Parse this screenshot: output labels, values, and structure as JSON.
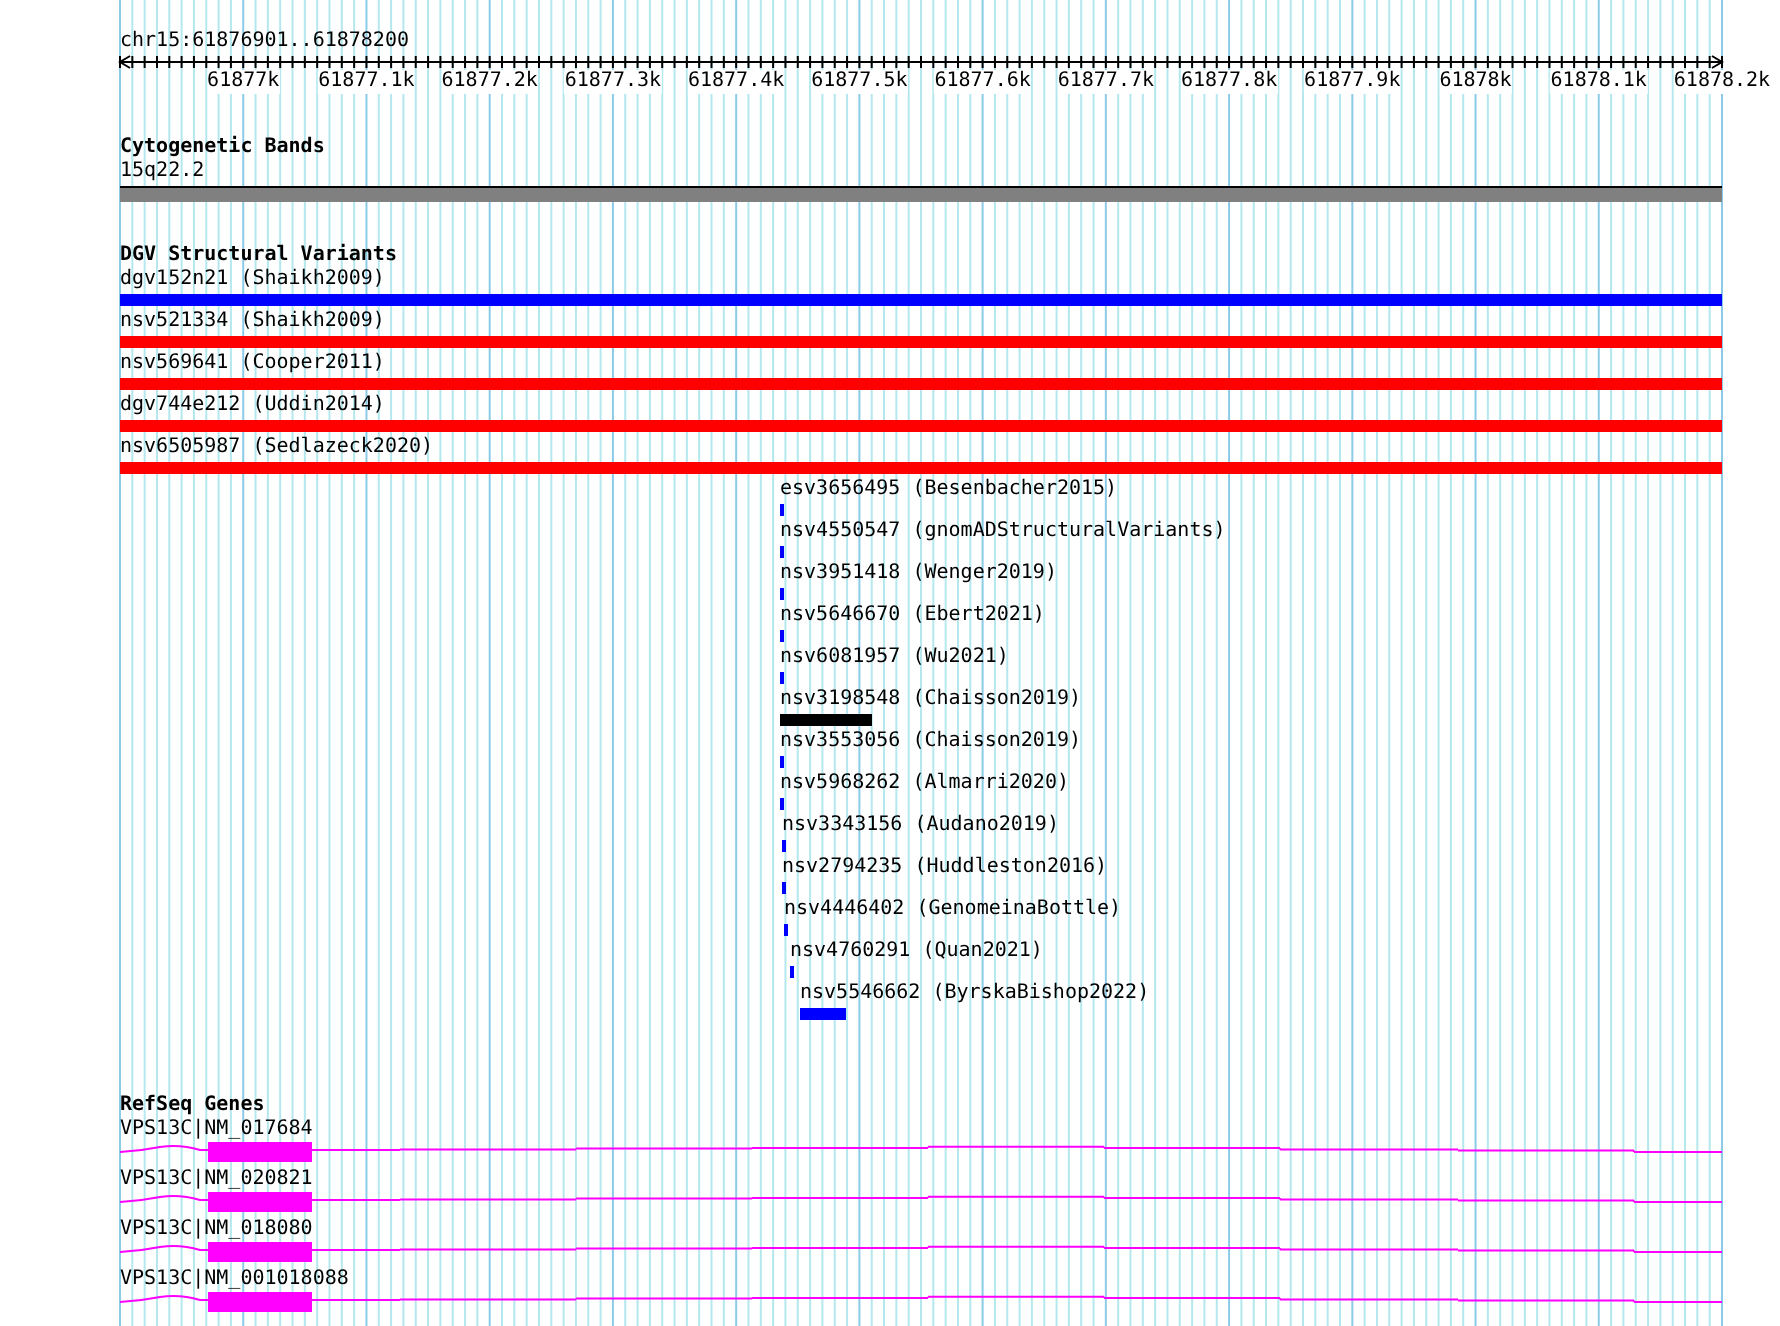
{
  "location": "chr15:61876901..61878200",
  "ruler": {
    "labels": [
      "61877k",
      "61877.1k",
      "61877.2k",
      "61877.3k",
      "61877.4k",
      "61877.5k",
      "61877.6k",
      "61877.7k",
      "61877.8k",
      "61877.9k",
      "61878k",
      "61878.1k",
      "61878.2k"
    ]
  },
  "cytogenetic_bands": {
    "title": "Cytogenetic Bands",
    "band": {
      "label": "15q22.2",
      "color": "#808080"
    }
  },
  "dgv_structural_variants": {
    "title": "DGV Structural Variants",
    "variants": [
      {
        "label": "dgv152n21 (Shaikh2009)",
        "color": "#0000ff"
      },
      {
        "label": "nsv521334 (Shaikh2009)",
        "color": "#ff0000"
      },
      {
        "label": "nsv569641 (Cooper2011)",
        "color": "#ff0000"
      },
      {
        "label": "dgv744e212 (Uddin2014)",
        "color": "#ff0000"
      },
      {
        "label": "nsv6505987 (Sedlazeck2020)",
        "color": "#ff0000"
      },
      {
        "label": "esv3656495 (Besenbacher2015)",
        "color": "#0000ff"
      },
      {
        "label": "nsv4550547 (gnomADStructuralVariants)",
        "color": "#0000ff"
      },
      {
        "label": "nsv3951418 (Wenger2019)",
        "color": "#0000ff"
      },
      {
        "label": "nsv5646670 (Ebert2021)",
        "color": "#0000ff"
      },
      {
        "label": "nsv6081957 (Wu2021)",
        "color": "#0000ff"
      },
      {
        "label": "nsv3198548 (Chaisson2019)",
        "color": "#000000"
      },
      {
        "label": "nsv3553056 (Chaisson2019)",
        "color": "#0000ff"
      },
      {
        "label": "nsv5968262 (Almarri2020)",
        "color": "#0000ff"
      },
      {
        "label": "nsv3343156 (Audano2019)",
        "color": "#0000ff"
      },
      {
        "label": "nsv2794235 (Huddleston2016)",
        "color": "#0000ff"
      },
      {
        "label": "nsv4446402 (GenomeinaBottle)",
        "color": "#0000ff"
      },
      {
        "label": "nsv4760291 (Quan2021)",
        "color": "#0000ff"
      },
      {
        "label": "nsv5546662 (ByrskaBishop2022)",
        "color": "#0000ff"
      }
    ]
  },
  "refseq_genes": {
    "title": "RefSeq Genes",
    "genes": [
      {
        "label": "VPS13C|NM_017684"
      },
      {
        "label": "VPS13C|NM_020821"
      },
      {
        "label": "VPS13C|NM_018080"
      },
      {
        "label": "VPS13C|NM_001018088"
      }
    ]
  }
}
